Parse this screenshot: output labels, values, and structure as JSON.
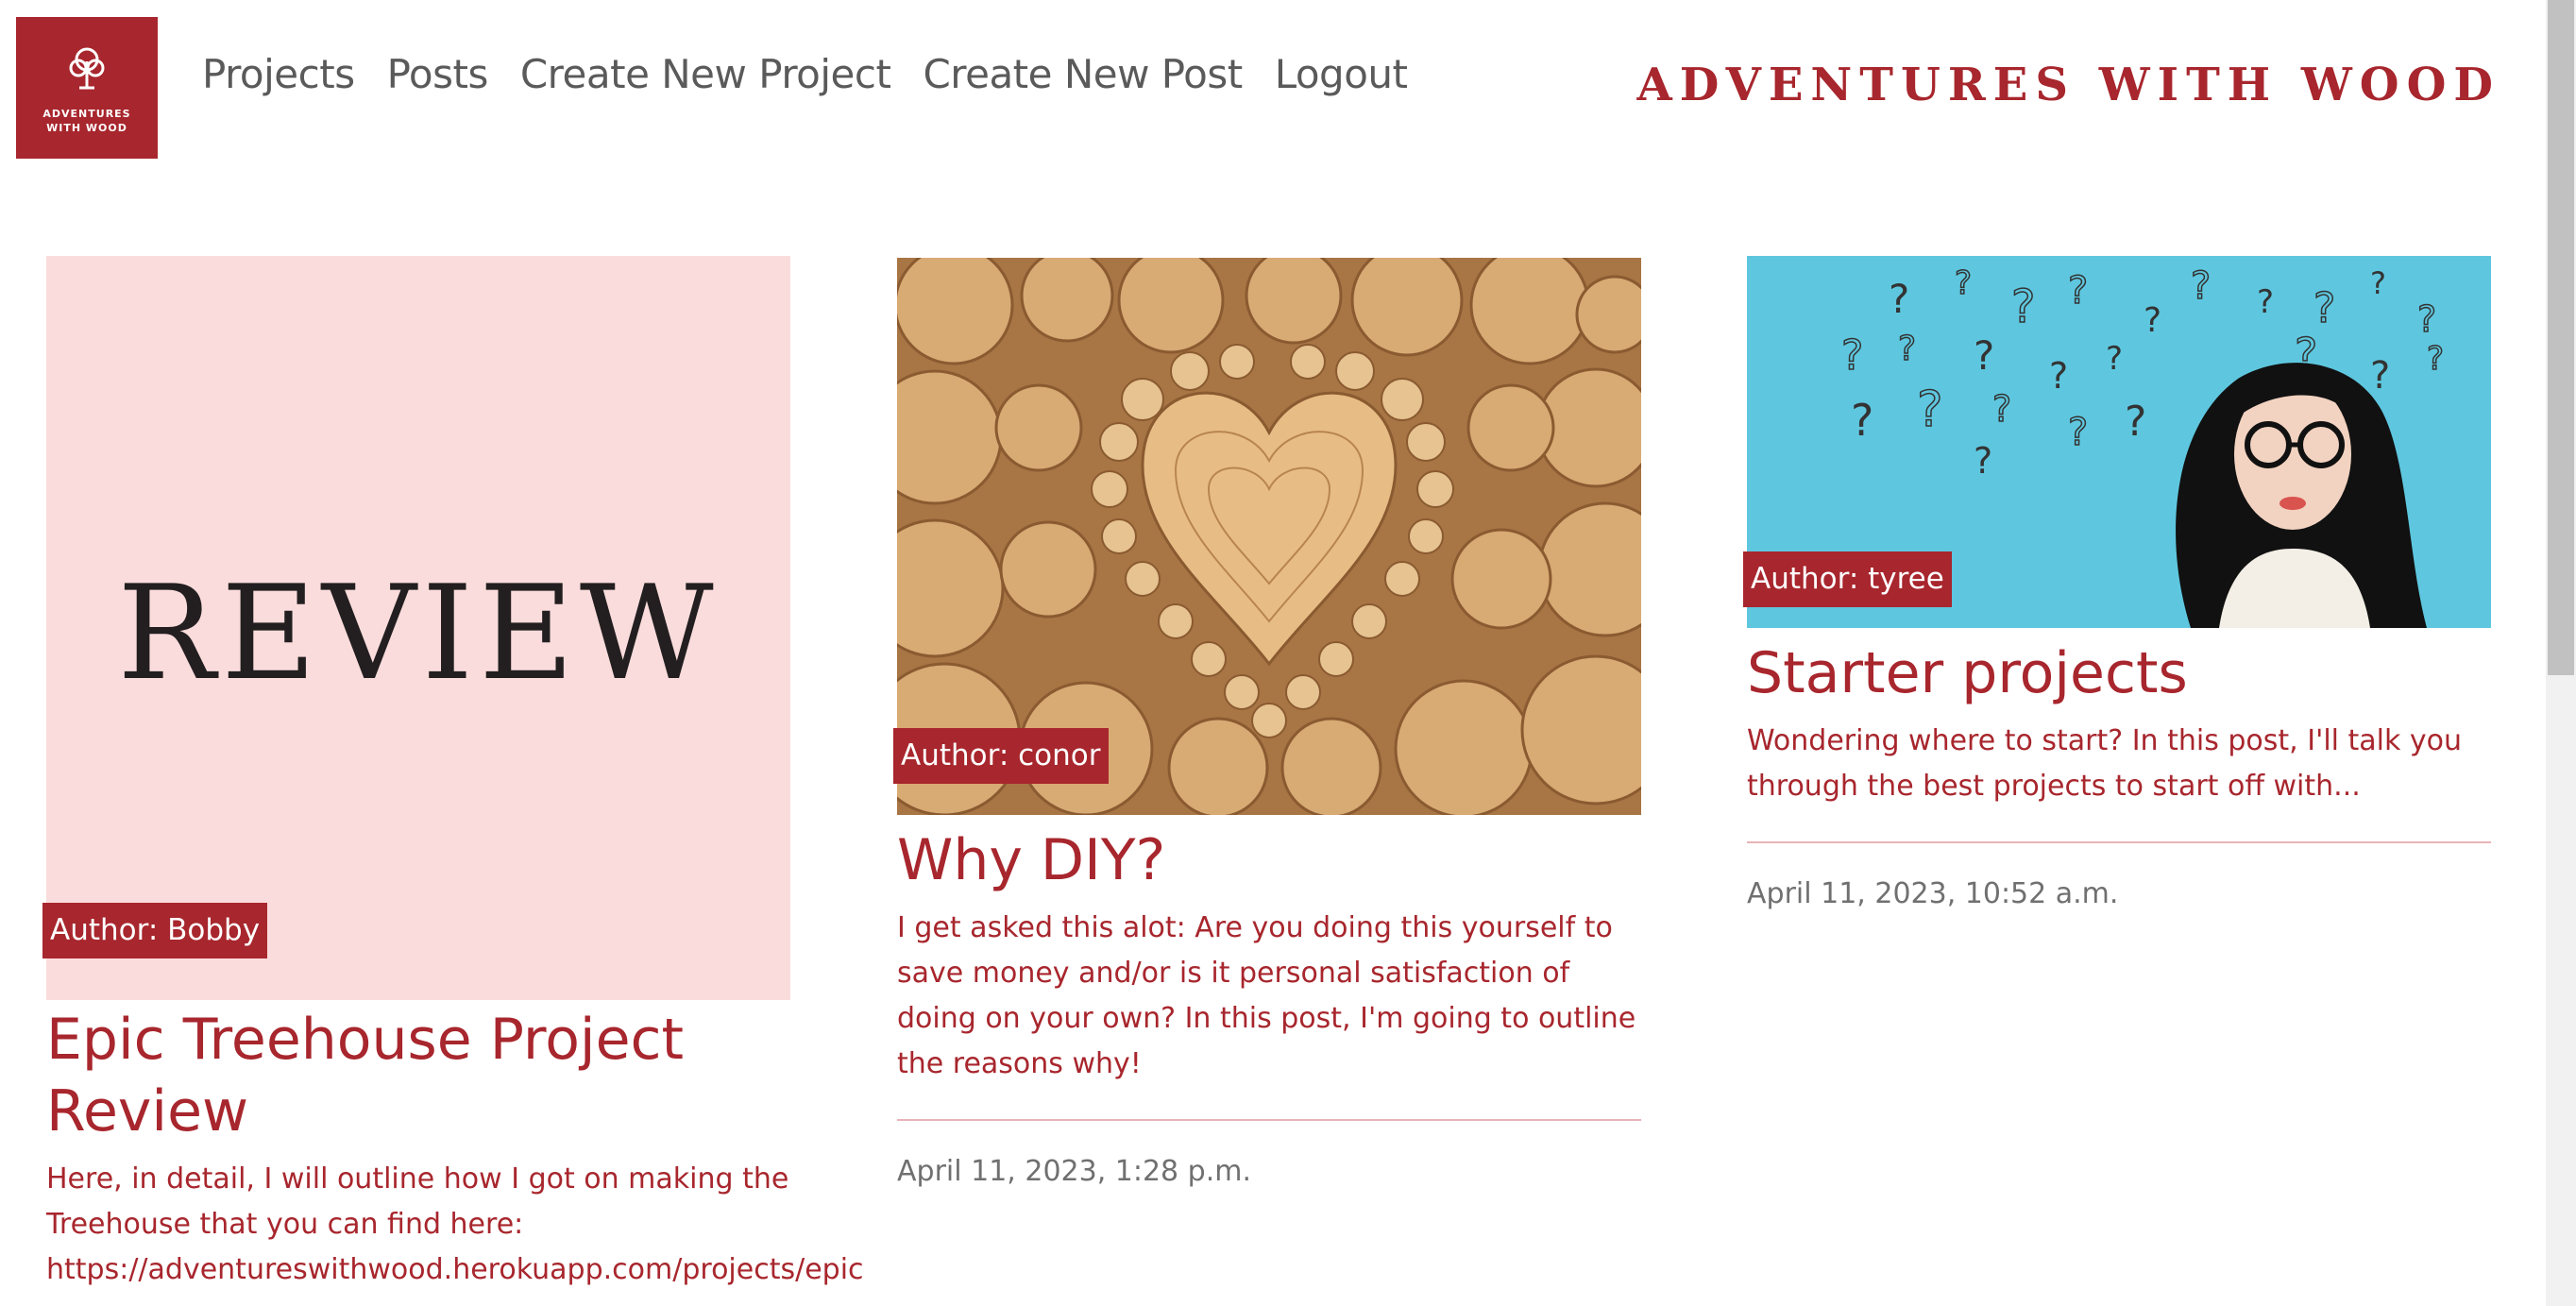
{
  "brand": {
    "logo_text": "ADVENTURES WITH WOOD",
    "title": "ADVENTURES WITH WOOD",
    "accent_color": "#a8262d"
  },
  "nav": {
    "items": [
      {
        "label": "Projects"
      },
      {
        "label": "Posts"
      },
      {
        "label": "Create New Project"
      },
      {
        "label": "Create New Post"
      },
      {
        "label": "Logout"
      }
    ]
  },
  "posts": [
    {
      "image_text": "REVIEW",
      "author": "Author: Bobby",
      "title": "Epic Treehouse Project Review",
      "excerpt_line1": "Here, in detail, I will outline how I got on making the",
      "excerpt_line2": "Treehouse that you can find here:",
      "excerpt_line3": "https://adventureswithwood.herokuapp.com/projects/epic"
    },
    {
      "author": "Author: conor",
      "title": "Why DIY?",
      "excerpt": "I get asked this alot: Are you doing this yourself to save money and/or is it personal satisfaction of doing on your own? In this post, I'm going to outline the reasons why!",
      "date": "April 11, 2023, 1:28 p.m."
    },
    {
      "author": "Author: tyree",
      "title": "Starter projects",
      "excerpt": "Wondering where to start? In this post, I'll talk you through the best projects to start off with...",
      "date": "April 11, 2023, 10:52 a.m."
    }
  ]
}
